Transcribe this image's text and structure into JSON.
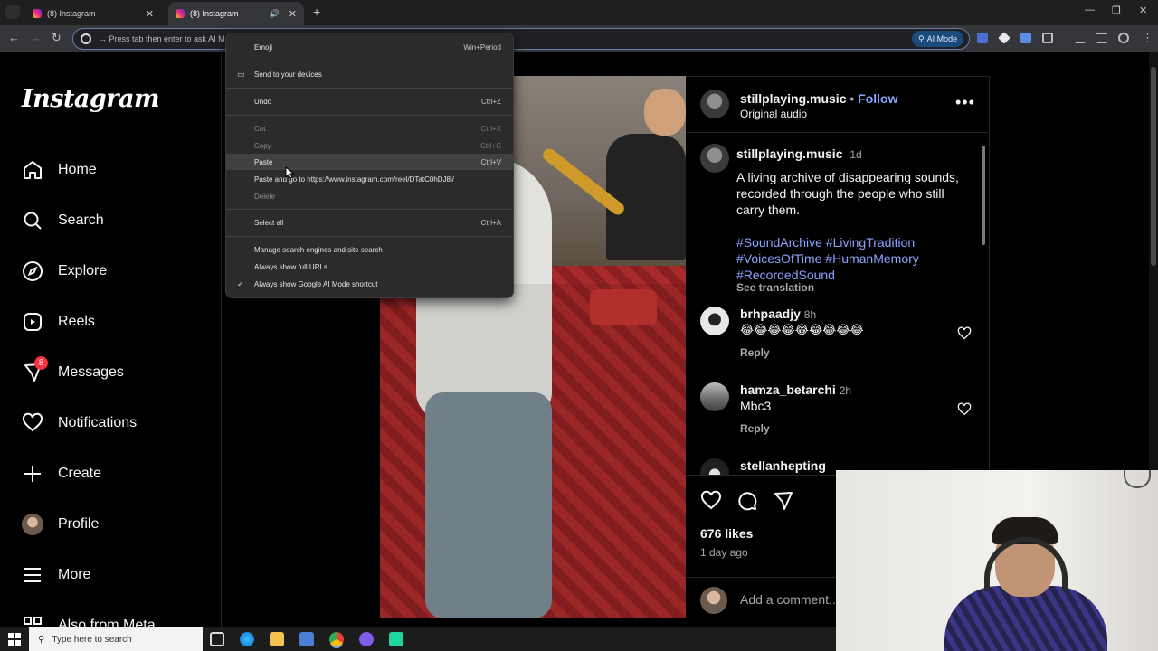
{
  "browser": {
    "tabs": [
      {
        "title": "(8) Instagram"
      },
      {
        "title": "(8) Instagram"
      }
    ],
    "omnibox_text": "→ Press tab then enter to ask AI M",
    "ai_mode_label": "AI Mode"
  },
  "context_menu": {
    "items": [
      {
        "label": "Emoji",
        "shortcut": "Win+Period"
      },
      {
        "label": "Send to your devices",
        "shortcut": ""
      },
      {
        "label": "Undo",
        "shortcut": "Ctrl+Z"
      },
      {
        "label": "Cut",
        "shortcut": "Ctrl+X"
      },
      {
        "label": "Copy",
        "shortcut": "Ctrl+C"
      },
      {
        "label": "Paste",
        "shortcut": "Ctrl+V"
      },
      {
        "label": "Paste and go to https://www.instagram.com/reel/DTatC0hDJ8i/",
        "shortcut": ""
      },
      {
        "label": "Delete",
        "shortcut": ""
      },
      {
        "label": "Select all",
        "shortcut": "Ctrl+A"
      },
      {
        "label": "Manage search engines and site search",
        "shortcut": ""
      },
      {
        "label": "Always show full URLs",
        "shortcut": ""
      },
      {
        "label": "Always show Google AI Mode shortcut",
        "shortcut": ""
      }
    ],
    "checkmark": "✓"
  },
  "sidebar": {
    "logo": "Instagram",
    "items": [
      {
        "label": "Home"
      },
      {
        "label": "Search"
      },
      {
        "label": "Explore"
      },
      {
        "label": "Reels"
      },
      {
        "label": "Messages",
        "badge": "8"
      },
      {
        "label": "Notifications"
      },
      {
        "label": "Create"
      },
      {
        "label": "Profile"
      },
      {
        "label": "More"
      },
      {
        "label": "Also from Meta"
      }
    ]
  },
  "post": {
    "author": "stillplaying.music",
    "separator": "•",
    "follow": "Follow",
    "audio": "Original audio",
    "caption_time": "1d",
    "caption": "A living archive of disappearing sounds, recorded through the people who still carry them.",
    "hashtags_line1": "#SoundArchive #LivingTradition",
    "hashtags_line2": "#VoicesOfTime #HumanMemory",
    "hashtags_line3": "#RecordedSound",
    "see_translation": "See translation",
    "comments": [
      {
        "user": "brhpaadjy",
        "time": "8h",
        "text": "😂😂😂😂😂😂😂😂😂",
        "reply": "Reply"
      },
      {
        "user": "hamza_betarchi",
        "time": "2h",
        "text": "Mbc3",
        "reply": "Reply"
      },
      {
        "user": "stellanhepting",
        "time": "",
        "text": "",
        "reply": ""
      }
    ],
    "likes": "676 likes",
    "posted_ago": "1 day ago",
    "add_comment_placeholder": "Add a comment..."
  },
  "taskbar": {
    "search_placeholder": "Type here to search"
  }
}
